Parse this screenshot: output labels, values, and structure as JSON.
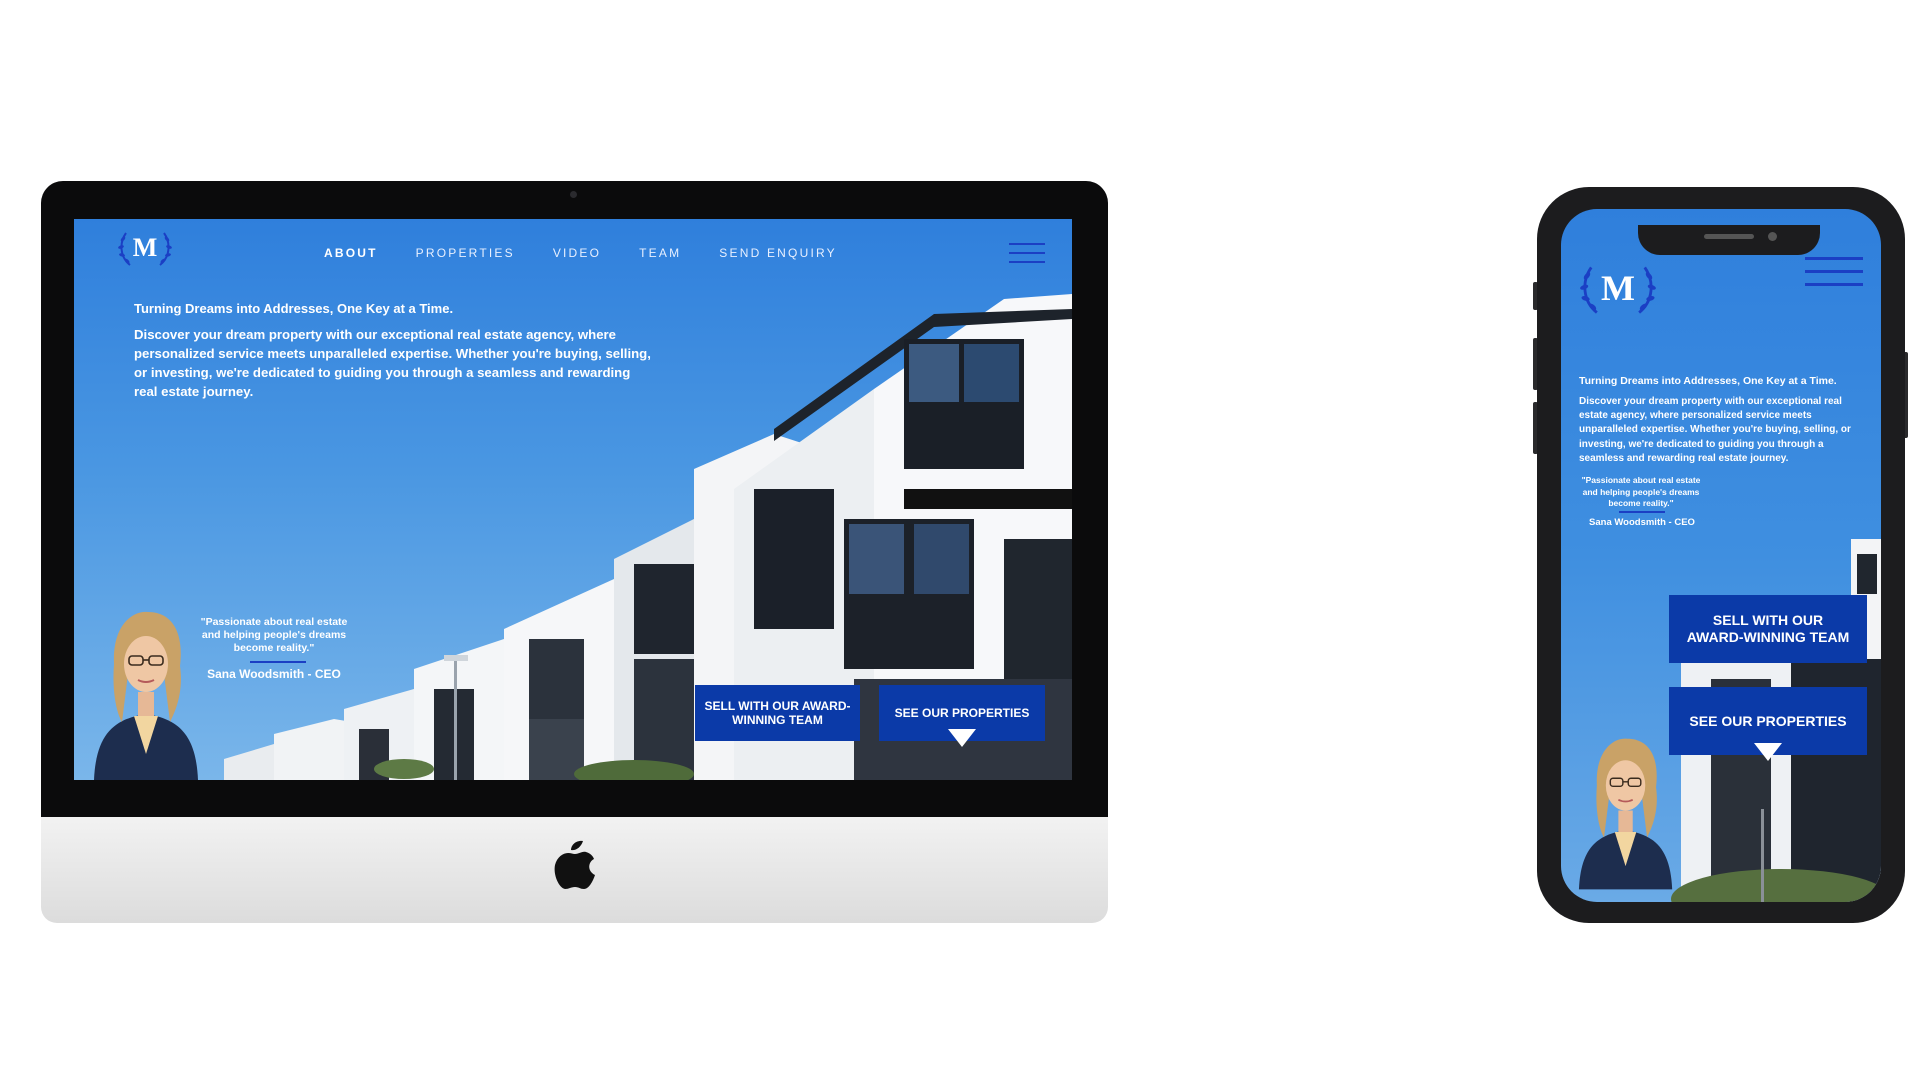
{
  "site": {
    "logo_letter": "M",
    "nav": [
      "ABOUT",
      "PROPERTIES",
      "VIDEO",
      "TEAM",
      "SEND ENQUIRY"
    ],
    "headline": "Turning Dreams into Addresses, One Key at a Time.",
    "description": "Discover your dream property with our exceptional real estate agency, where personalized service meets unparalleled expertise. Whether you're buying, selling, or investing, we're dedicated to guiding you through a seamless and rewarding real estate journey.",
    "quote": "\"Passionate about real estate and helping people's dreams become reality.\"",
    "signature": "Sana Woodsmith - CEO",
    "cta_sell": "SELL WITH OUR AWARD-WINNING TEAM",
    "cta_properties": "SEE OUR PROPERTIES"
  },
  "icons": {
    "logo": "laurel-wreath-logo",
    "menu": "hamburger-menu-icon",
    "apple": "apple-logo"
  },
  "colors": {
    "accent": "#0b3aa8",
    "sky_top": "#2f7fdc",
    "sky_bottom": "#7ab6ea",
    "text": "#ffffff"
  }
}
